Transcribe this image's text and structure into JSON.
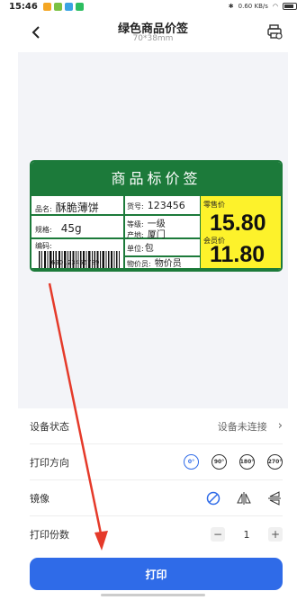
{
  "status_bar": {
    "time": "15:46",
    "network_speed": "0.60",
    "network_unit": "KB/s"
  },
  "header": {
    "title": "绿色商品价签",
    "subtitle": "70*38mm"
  },
  "label": {
    "heading": "商品标价签",
    "name_key": "品名:",
    "name_val": "酥脆薄饼",
    "spec_key": "规格:",
    "spec_val": "45g",
    "code_key": "编码:",
    "barcode_number": "690123456789",
    "item_no_key": "货号:",
    "item_no_val": "123456",
    "grade_key": "等级:",
    "grade_val": "一级",
    "origin_key": "产地:",
    "origin_val": "厦门",
    "unit_key": "单位:",
    "unit_val": "包",
    "pricer_key": "物价员:",
    "pricer_val": "物价员",
    "retail_label": "零售价",
    "retail_price": "15.80",
    "member_label": "会员价",
    "member_price": "11.80",
    "colors": {
      "green": "#1c7a3a",
      "yellow": "#fdf22b"
    }
  },
  "settings": {
    "device_status_label": "设备状态",
    "device_status_value": "设备未连接",
    "direction_label": "打印方向",
    "directions": [
      "0°",
      "90°",
      "180°",
      "270°"
    ],
    "mirror_label": "镜像",
    "copies_label": "打印份数",
    "copies_value": "1"
  },
  "print_button": "打印",
  "accent_color": "#2f6be8"
}
